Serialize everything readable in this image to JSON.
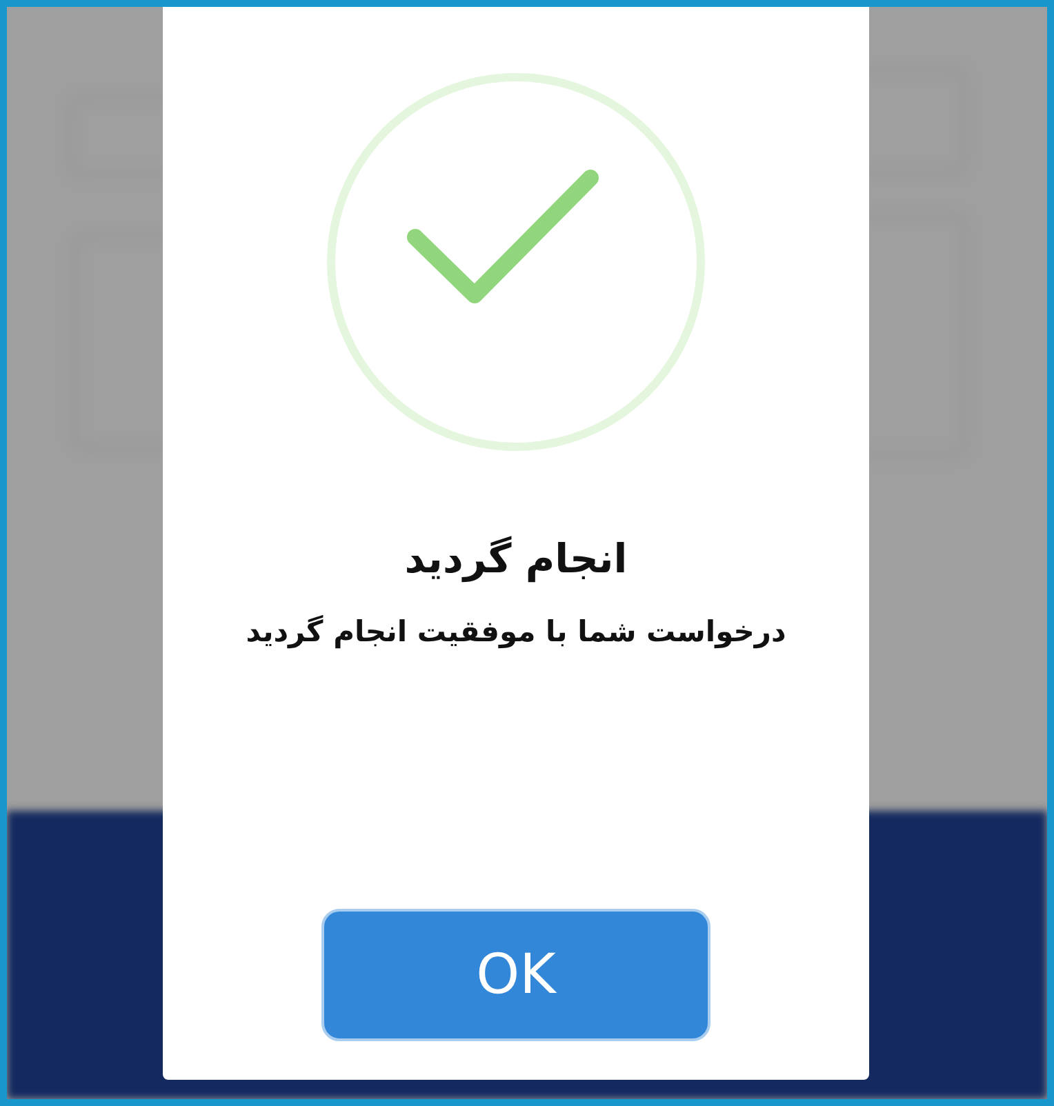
{
  "dialog": {
    "title": "انجام گردید",
    "message": "درخواست شما با موفقیت انجام گردید",
    "button": "OK"
  }
}
